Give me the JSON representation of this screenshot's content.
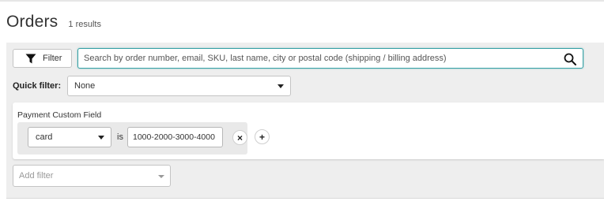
{
  "header": {
    "title": "Orders",
    "results_count": "1 results"
  },
  "toolbar": {
    "filter_button_label": "Filter",
    "filter_icon": "funnel-icon",
    "search_placeholder": "Search by order number, email, SKU, last name, city or postal code (shipping / billing address)",
    "search_value": "",
    "search_icon": "search-icon",
    "accent_color": "#34a0a4"
  },
  "quick_filter": {
    "label": "Quick filter:",
    "selected": "None"
  },
  "active_filter": {
    "title": "Payment Custom Field",
    "condition": {
      "field": "card",
      "operator": "is",
      "value": "1000-2000-3000-4000",
      "remove_symbol": "×",
      "add_symbol": "+"
    }
  },
  "add_filter": {
    "placeholder": "Add filter"
  }
}
